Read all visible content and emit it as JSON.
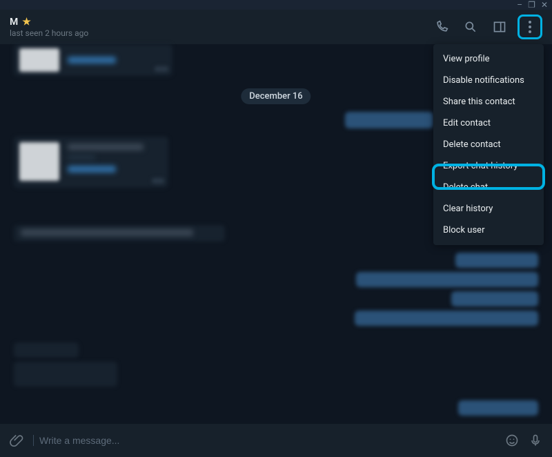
{
  "window": {
    "minimize": "–",
    "maximize": "❐",
    "close": "✕"
  },
  "header": {
    "contact_name": "M",
    "last_seen": "last seen 2 hours ago"
  },
  "chat": {
    "date_divider": "December 16"
  },
  "menu": {
    "items": [
      "View profile",
      "Disable notifications",
      "Share this contact",
      "Edit contact",
      "Delete contact",
      "Export chat history",
      "Delete chat",
      "Clear history",
      "Block user"
    ]
  },
  "composer": {
    "placeholder": "Write a message..."
  }
}
